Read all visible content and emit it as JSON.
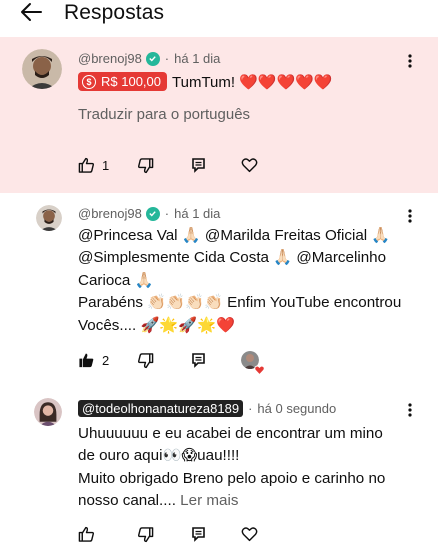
{
  "header": {
    "title": "Respostas",
    "back_icon": "arrow-left-icon"
  },
  "top_comment": {
    "author": "@brenoj98",
    "verified": true,
    "time": "há 1 dia",
    "super_thanks_amount": "R$ 100,00",
    "text": "TumTum! ❤️❤️❤️❤️❤️",
    "translate_label": "Traduzir para o português",
    "like_count": "1",
    "background": "#fde7e7",
    "badge_color": "#e53935"
  },
  "replies": [
    {
      "author": "@brenoj98",
      "verified": true,
      "time": "há 1 dia",
      "lines": [
        "@Princesa Val 🙏🏻 @Marilda Freitas Oficial 🙏🏻",
        "@Simplesmente Cida Costa 🙏🏻 @Marcelinho",
        "Carioca 🙏🏻",
        "Parabéns 👏🏻👏🏻👏🏻👏🏻  Enfim YouTube encontrou",
        "Vocês.... 🚀🌟🚀🌟❤️"
      ],
      "like_count": "2",
      "liked": true,
      "creator_hearted": true
    },
    {
      "author": "@todeolhonanatureza8189",
      "time": "há 0 segundo",
      "lines": [
        "Uhuuuuuu e eu acabei de encontrar um mino",
        "de ouro aqui👀😱uau!!!!",
        "Muito obrigado Breno pelo apoio e carinho no"
      ],
      "last_line": "nosso canal....",
      "read_more": "Ler mais"
    }
  ],
  "colors": {
    "verified": "#25b79a",
    "meta": "#606060",
    "heart": "#e53935"
  }
}
